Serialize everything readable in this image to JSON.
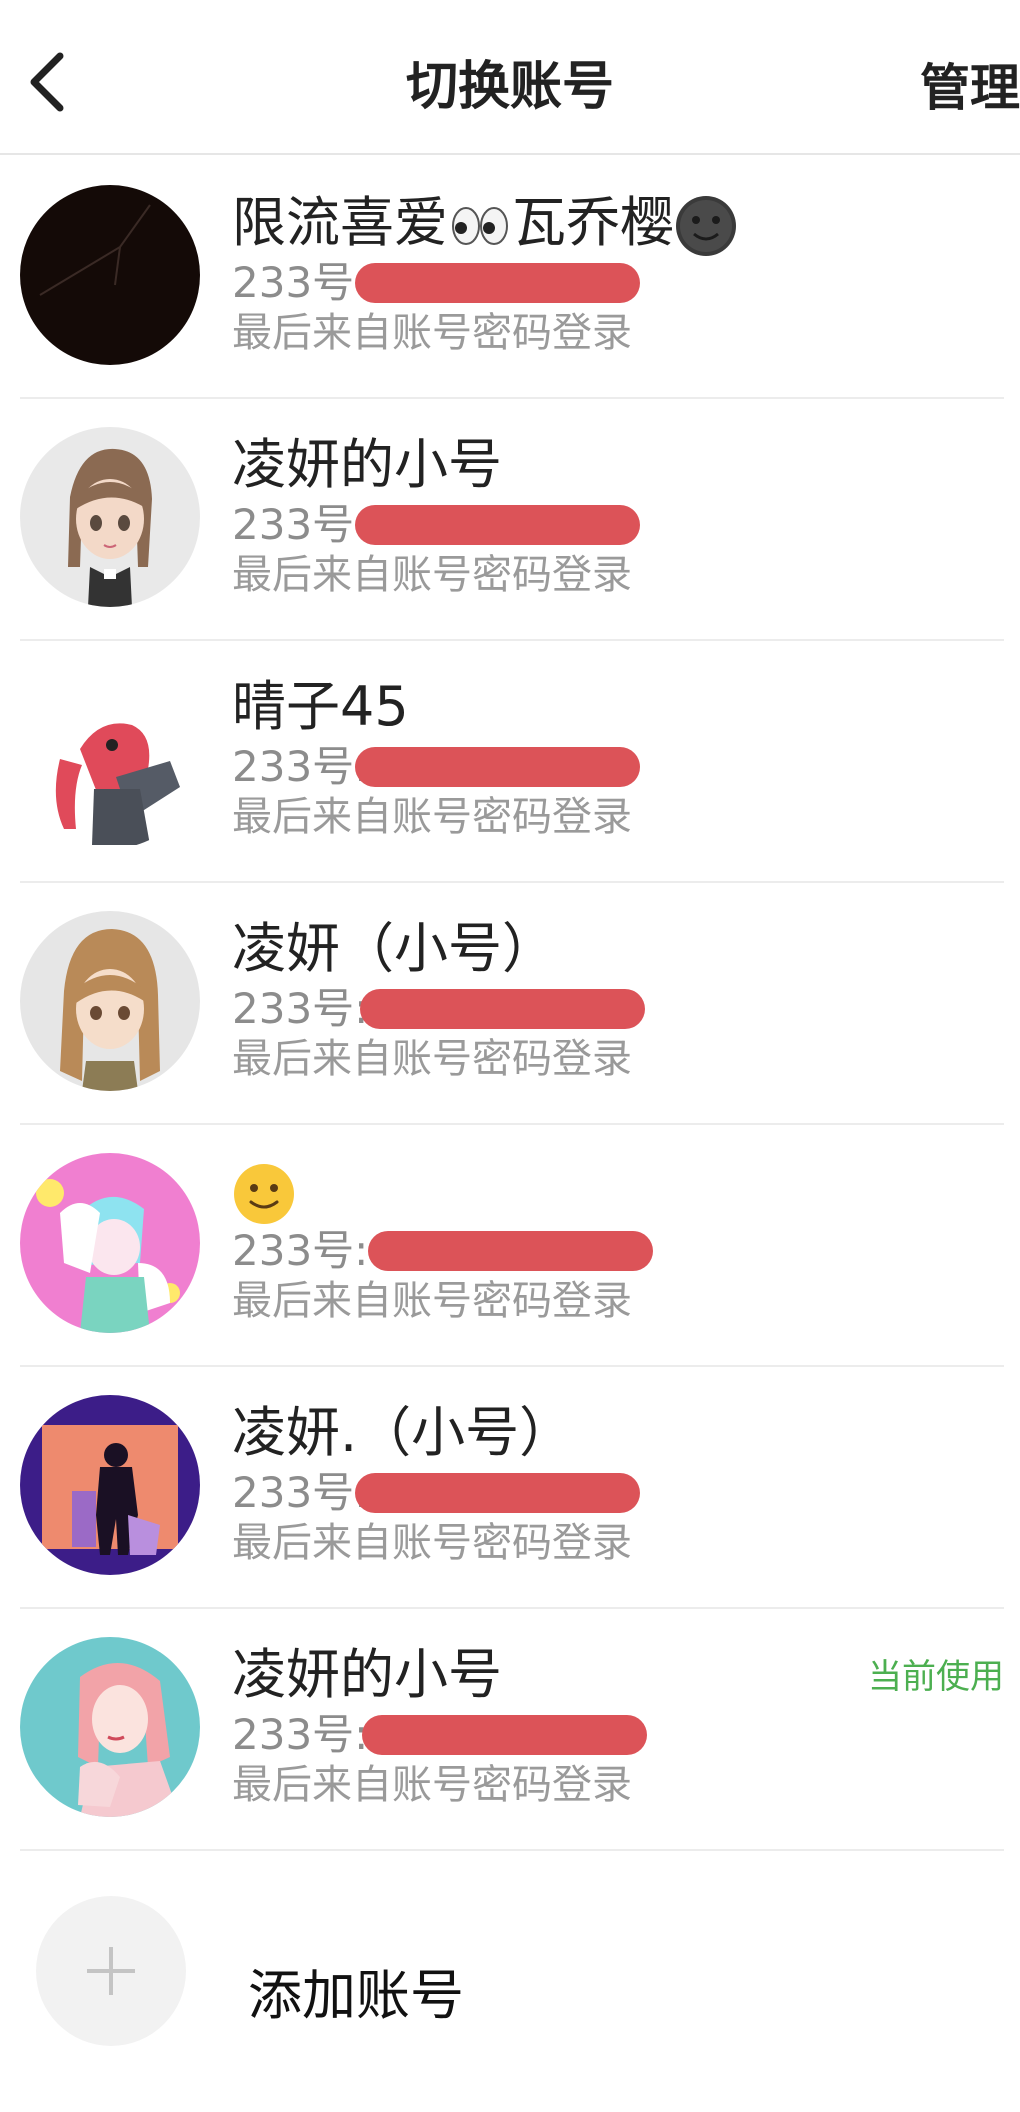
{
  "header": {
    "title": "切换账号",
    "manage_label": "管理"
  },
  "accounts": [
    {
      "name": "限流喜爱",
      "name_suffix": "瓦乔樱",
      "number_label": "233号",
      "login_method": "最后来自账号密码登录",
      "avatar": "dark-avatar"
    },
    {
      "name": "凌妍的小号",
      "number_label": "233号",
      "login_method": "最后来自账号密码登录",
      "avatar": "anime-girl-brown-braids"
    },
    {
      "name": "晴子45",
      "number_label": "233号:",
      "login_method": "最后来自账号密码登录",
      "avatar": "anime-girl-red-hair"
    },
    {
      "name": "凌妍（小号）",
      "number_label": "233号:",
      "login_method": "最后来自账号密码登录",
      "avatar": "anime-girl-light-brown"
    },
    {
      "name": "",
      "number_label": "233号:",
      "login_method": "最后来自账号密码登录",
      "avatar": "anime-boy-pink-bg",
      "name_emoji": "slightly-smiling-face"
    },
    {
      "name": "凌妍.（小号）",
      "number_label": "233号:",
      "login_method": "最后来自账号密码登录",
      "avatar": "silhouette-purple-frame"
    },
    {
      "name": "凌妍的小号",
      "number_label": "233号:",
      "login_method": "最后来自账号密码登录",
      "avatar": "anime-girl-teal-bg",
      "badge": "当前使用"
    }
  ],
  "add_account": {
    "label": "添加账号"
  },
  "colors": {
    "current_badge": "#4caf50",
    "redaction": "#dc5358"
  }
}
